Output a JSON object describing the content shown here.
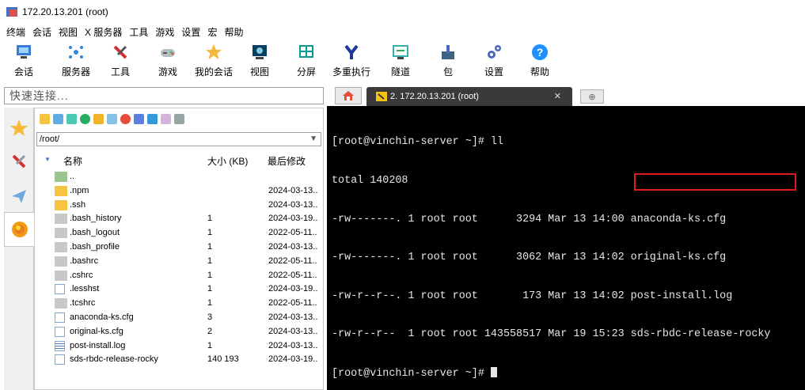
{
  "window": {
    "title": "172.20.13.201 (root)"
  },
  "menu": [
    "终端",
    "会话",
    "视图",
    "X 服务器",
    "工具",
    "游戏",
    "设置",
    "宏",
    "帮助"
  ],
  "toolbar": [
    {
      "label": "会话",
      "icon": "session-icon",
      "color": "#3a7bd5"
    },
    {
      "label": "服务器",
      "icon": "servers-icon",
      "color": "#2e86de"
    },
    {
      "label": "工具",
      "icon": "tools-icon",
      "color": "#d63031"
    },
    {
      "label": "游戏",
      "icon": "games-icon",
      "color": "#636e72"
    },
    {
      "label": "我的会话",
      "icon": "star-icon",
      "color": "#f6b93b"
    },
    {
      "label": "视图",
      "icon": "view-icon",
      "color": "#0a3d62"
    },
    {
      "label": "分屏",
      "icon": "split-icon",
      "color": "#079992"
    },
    {
      "label": "多重执行",
      "icon": "multiexec-icon",
      "color": "#1e3799"
    },
    {
      "label": "隧道",
      "icon": "tunnel-icon",
      "color": "#38ada9"
    },
    {
      "label": "包",
      "icon": "packages-icon",
      "color": "#3c6382"
    },
    {
      "label": "设置",
      "icon": "settings-icon",
      "color": "#4a69bd"
    },
    {
      "label": "帮助",
      "icon": "help-icon",
      "color": "#1e90ff"
    }
  ],
  "quick_connect": {
    "placeholder": "快速连接..."
  },
  "sftp": {
    "path": "/root/",
    "columns": {
      "name": "名称",
      "size": "大小 (KB)",
      "modified": "最后修改"
    },
    "files": [
      {
        "name": "..",
        "size": "",
        "modified": "",
        "icon": "folder-up-icon"
      },
      {
        "name": ".npm",
        "size": "",
        "modified": "2024-03-13..",
        "icon": "folder-icon"
      },
      {
        "name": ".ssh",
        "size": "",
        "modified": "2024-03-13..",
        "icon": "folder-icon"
      },
      {
        "name": ".bash_history",
        "size": "1",
        "modified": "2024-03-19..",
        "icon": "file-icon"
      },
      {
        "name": ".bash_logout",
        "size": "1",
        "modified": "2022-05-11..",
        "icon": "file-icon"
      },
      {
        "name": ".bash_profile",
        "size": "1",
        "modified": "2024-03-13..",
        "icon": "file-icon"
      },
      {
        "name": ".bashrc",
        "size": "1",
        "modified": "2022-05-11..",
        "icon": "file-icon"
      },
      {
        "name": ".cshrc",
        "size": "1",
        "modified": "2022-05-11..",
        "icon": "file-icon"
      },
      {
        "name": ".lesshst",
        "size": "1",
        "modified": "2024-03-19..",
        "icon": "doc-icon"
      },
      {
        "name": ".tcshrc",
        "size": "1",
        "modified": "2022-05-11..",
        "icon": "file-icon"
      },
      {
        "name": "anaconda-ks.cfg",
        "size": "3",
        "modified": "2024-03-13..",
        "icon": "cfg-icon"
      },
      {
        "name": "original-ks.cfg",
        "size": "2",
        "modified": "2024-03-13..",
        "icon": "cfg-icon"
      },
      {
        "name": "post-install.log",
        "size": "1",
        "modified": "2024-03-13..",
        "icon": "log-icon"
      },
      {
        "name": "sds-rbdc-release-rocky",
        "size": "140 193",
        "modified": "2024-03-19..",
        "icon": "doc-icon"
      }
    ]
  },
  "tabs": {
    "active_label": "2. 172.20.13.201 (root)"
  },
  "terminal": {
    "lines": [
      "[root@vinchin-server ~]# ll",
      "total 140208",
      "-rw-------. 1 root root      3294 Mar 13 14:00 anaconda-ks.cfg",
      "-rw-------. 1 root root      3062 Mar 13 14:02 original-ks.cfg",
      "-rw-r--r--. 1 root root       173 Mar 13 14:02 post-install.log",
      "-rw-r--r--  1 root root 143558517 Mar 19 15:23 sds-rbdc-release-rocky"
    ],
    "prompt": "[root@vinchin-server ~]# "
  }
}
